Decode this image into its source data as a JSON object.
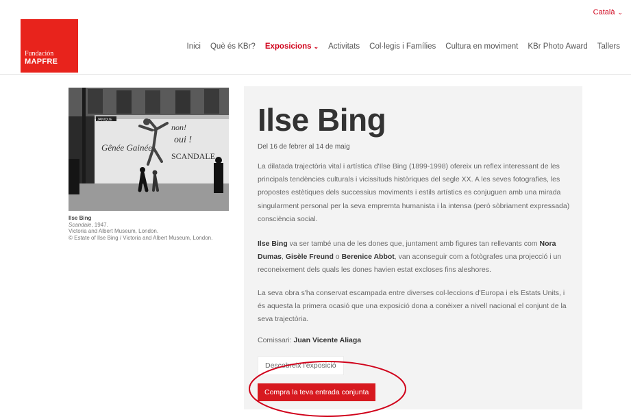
{
  "header": {
    "language": "Català",
    "logo": {
      "line1": "Fundación",
      "line2": "MAPFRE"
    },
    "nav": [
      {
        "label": "Inici",
        "active": false
      },
      {
        "label": "Què és KBr?",
        "active": false
      },
      {
        "label": "Exposicions",
        "active": true
      },
      {
        "label": "Activitats",
        "active": false
      },
      {
        "label": "Col·legis i Famílies",
        "active": false
      },
      {
        "label": "Cultura en moviment",
        "active": false
      },
      {
        "label": "KBr Photo Award",
        "active": false
      },
      {
        "label": "Tallers",
        "active": false
      }
    ]
  },
  "photo": {
    "poster_text": {
      "left": "Gênée Gainée",
      "right_top": "non!",
      "right_mid": "oui !",
      "right_bottom": "SCANDALE",
      "banner": "JANIQUE"
    }
  },
  "credit": {
    "artist": "Ilse Bing",
    "work": "Scandale",
    "year": ", 1947.",
    "museum": "Victoria and Albert Museum, London.",
    "copyright": "© Estate of Ilse Bing / Victoria and Albert Museum, London."
  },
  "exhibition": {
    "title": "Ilse Bing",
    "dates": "Del 16 de febrer al 14 de maig",
    "paragraph1": "La dilatada trajectòria vital i artística d'Ilse Bing (1899-1998) ofereix un reflex interessant de les principals tendències culturals i vicissituds històriques del segle XX. A les seves fotografies, les propostes estètiques dels successius moviments i estils artístics es conjuguen amb una mirada singularment personal per la seva empremta humanista i la intensa (però sòbriament expressada) consciència social.",
    "paragraph2": {
      "name1": "Ilse Bing",
      "text1": " va ser també una de les dones que, juntament amb figures tan rellevants com ",
      "name2": "Nora Dumas",
      "sep1": ", ",
      "name3": "Gisèle Freund",
      "sep2": " o ",
      "name4": "Berenice Abbot",
      "text2": ", van aconseguir com a fotògrafes una projecció i un reconeixement dels quals les dones havien estat excloses fins aleshores."
    },
    "paragraph3": "La seva obra s'ha conservat escampada entre diverses col·leccions d'Europa i els Estats Units, i és aquesta la primera ocasió que una exposició dona a conèixer a nivell nacional el conjunt de la seva trajectòria.",
    "curator_label": "Comissari: ",
    "curator_name": "Juan Vicente Aliaga",
    "discover_button": "Descobreix l'exposició",
    "buy_button": "Compra la teva entrada conjunta"
  },
  "colors": {
    "brand_red": "#e8231c",
    "button_red": "#d7191f",
    "nav_active": "#d0021b",
    "annotation_circle": "#d0021b"
  }
}
